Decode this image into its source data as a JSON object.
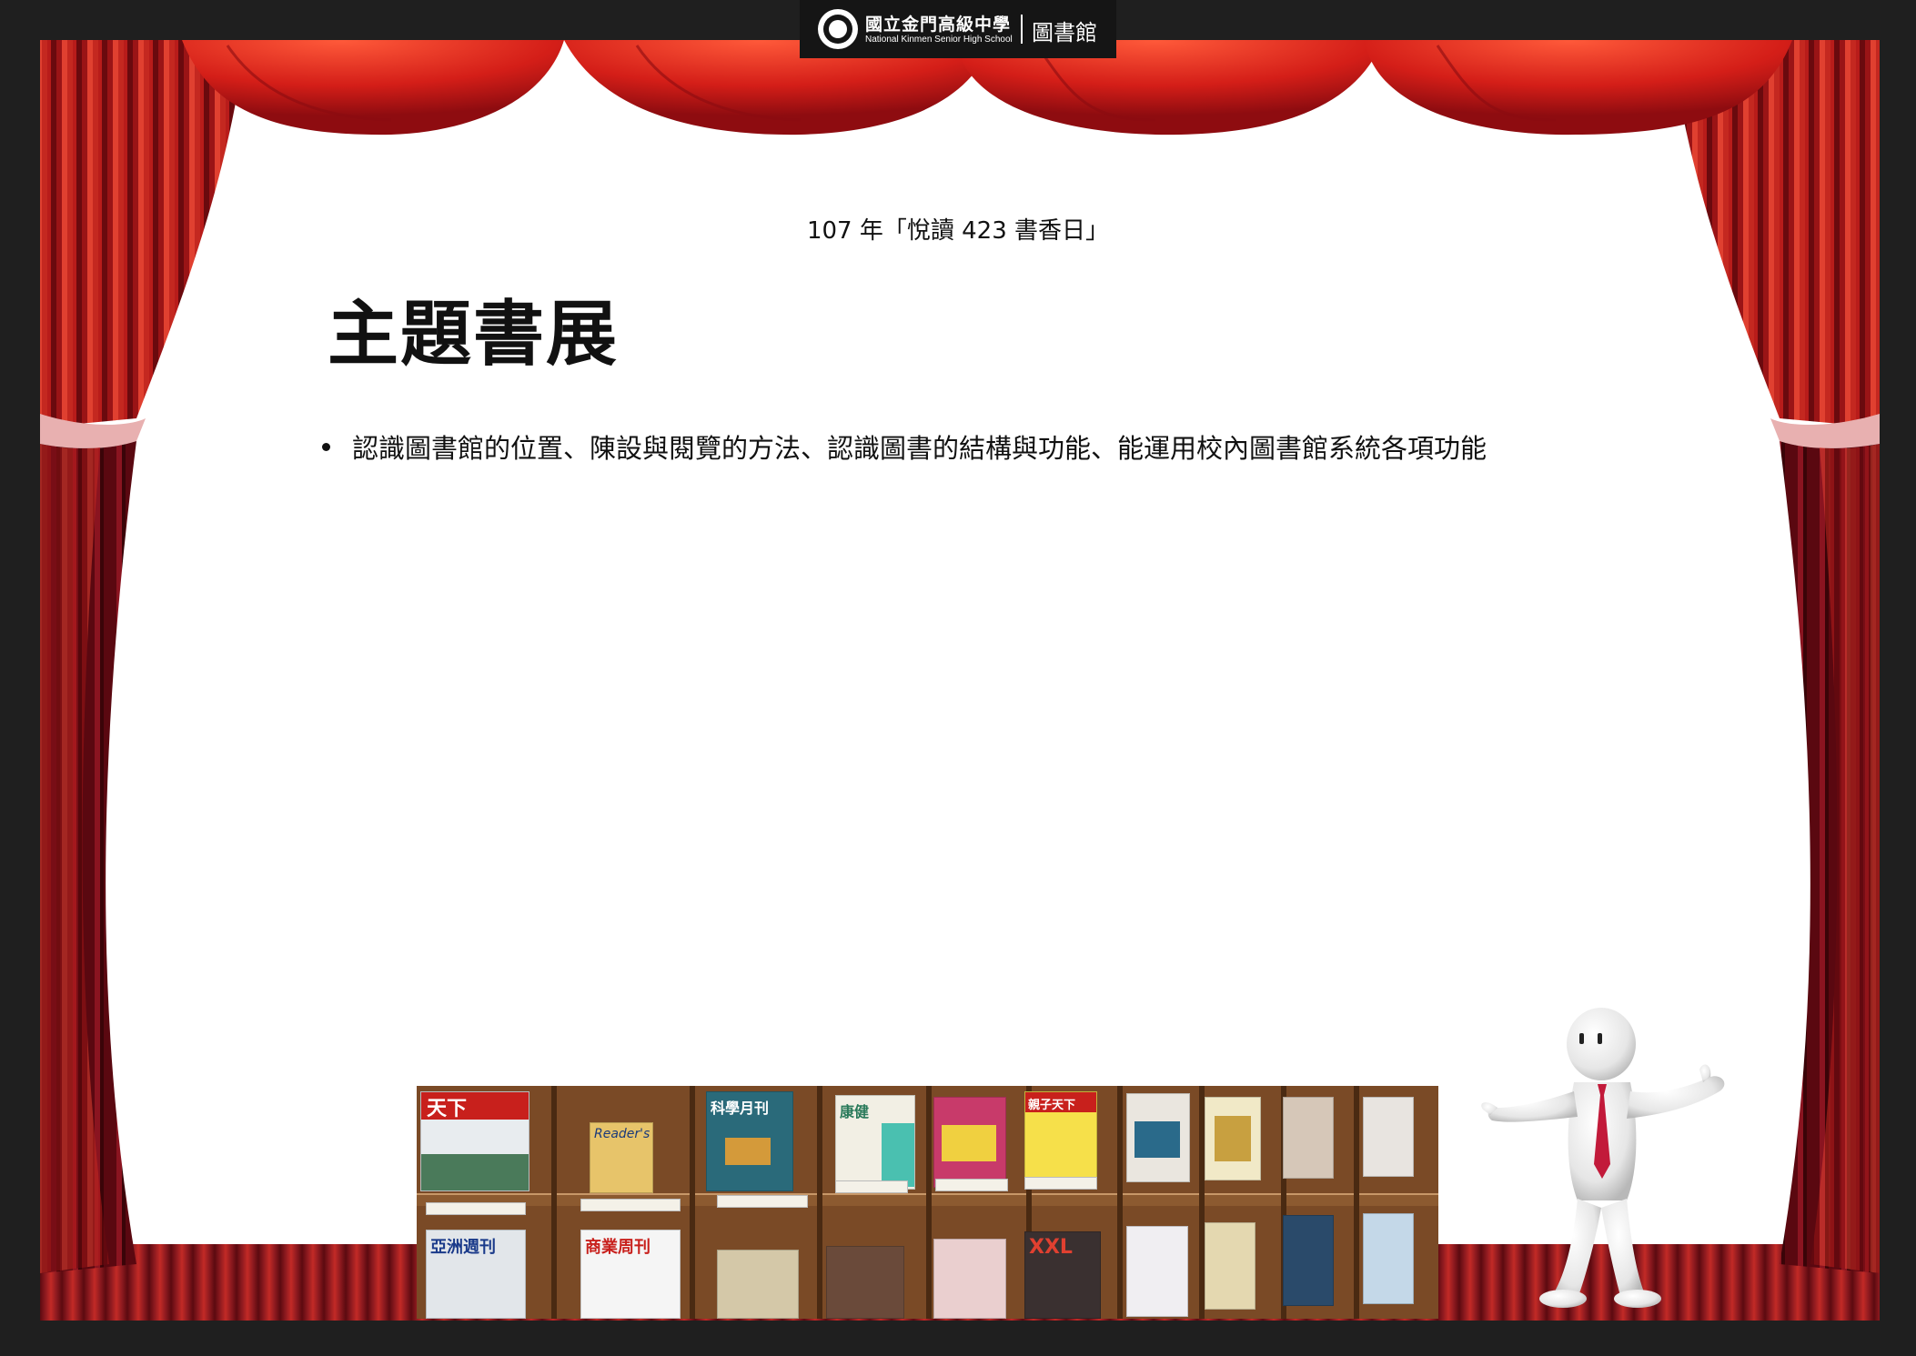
{
  "header": {
    "school_name_zh": "國立金門高級中學",
    "school_name_en": "National Kinmen Senior High School",
    "unit": "圖書館"
  },
  "slide": {
    "event_title": "107 年「悅讀 423 書香日」",
    "title": "主題書展",
    "bullets": [
      "認識圖書館的位置、陳設與閱覽的方法、認識圖書的結構與功能、能運用校內圖書館系統各項功能"
    ]
  },
  "photo": {
    "magazine_titles": [
      "天下",
      "Reader's",
      "科學月刊",
      "康健",
      "親子天下",
      "XXL",
      "亞洲週刊",
      "商業周刊"
    ]
  },
  "colors": {
    "curtain_red": "#c8201c",
    "curtain_dark": "#6e0a10",
    "background": "#1f1f1f",
    "stage": "#ffffff"
  }
}
